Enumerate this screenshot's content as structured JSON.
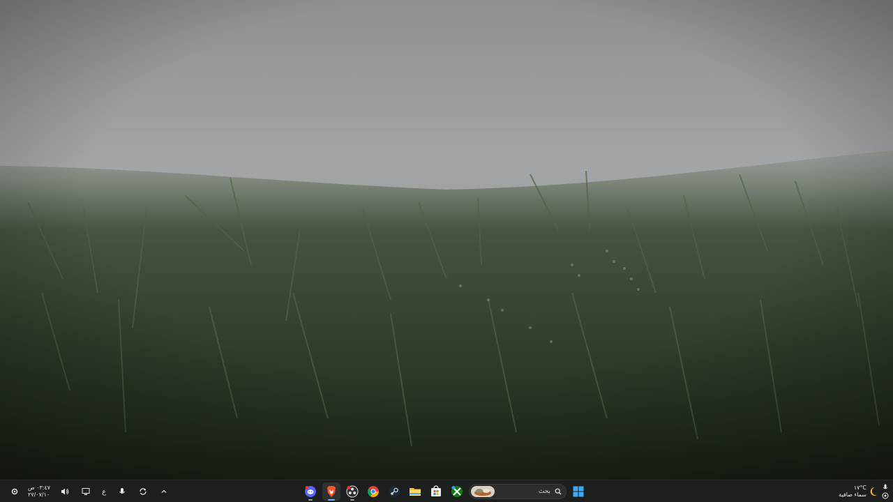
{
  "taskbar": {
    "clock": {
      "time": "٠٣:٤٧ ص",
      "date": "٢٧/٠٧/١٠"
    },
    "language": "ع",
    "search": {
      "placeholder": "بحث"
    },
    "weather": {
      "temperature": "١٧°C",
      "condition": "سماء صافية"
    },
    "apps": [
      {
        "name": "discord",
        "icon": "discord-icon",
        "color": "#5865F2",
        "badge": ""
      },
      {
        "name": "brave",
        "icon": "brave-icon",
        "color": "#FB542B",
        "badge": ""
      },
      {
        "name": "obs",
        "icon": "obs-icon",
        "color": "#302E31",
        "badge": ""
      },
      {
        "name": "chrome",
        "icon": "chrome-icon",
        "color": "#4285F4",
        "badge": ""
      },
      {
        "name": "steam",
        "icon": "steam-icon",
        "color": "#1B2838",
        "badge": ""
      },
      {
        "name": "file-explorer",
        "icon": "folder-icon",
        "color": "#F4C23E",
        "badge": ""
      },
      {
        "name": "microsoft-store",
        "icon": "store-icon",
        "color": "#F3F3F3",
        "badge": ""
      },
      {
        "name": "xbox",
        "icon": "xbox-icon",
        "color": "#107C10",
        "badge": ""
      }
    ],
    "start": {
      "icon": "windows-start-icon",
      "color": "#3FA9F5"
    }
  }
}
